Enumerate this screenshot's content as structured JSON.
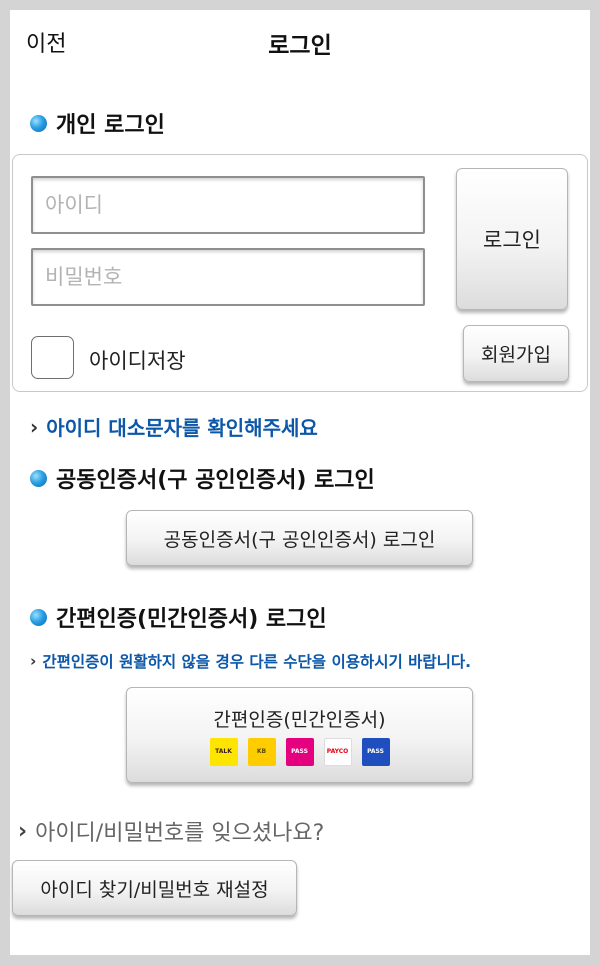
{
  "header": {
    "back_label": "이전",
    "title": "로그인"
  },
  "personal": {
    "title": "개인 로그인",
    "id_placeholder": "아이디",
    "pw_placeholder": "비밀번호",
    "login_button": "로그인",
    "save_id_label": "아이디저장",
    "signup_button": "회원가입"
  },
  "id_hint": "아이디 대소문자를 확인해주세요",
  "cert": {
    "title": "공동인증서(구 공인인증서) 로그인",
    "button": "공동인증서(구 공인인증서) 로그인"
  },
  "simple": {
    "title": "간편인증(민간인증서) 로그인",
    "hint": "간편인증이 원활하지 않을 경우 다른 수단을 이용하시기 바랍니다.",
    "button": "간편인증(민간인증서)",
    "providers": [
      {
        "label": "TALK",
        "color": "#fee500",
        "text_color": "#3c1e1e"
      },
      {
        "label": "KB",
        "color": "#ffcc00",
        "text_color": "#5a4a00"
      },
      {
        "label": "PASS",
        "color": "#e4007f",
        "text_color": "#ffffff"
      },
      {
        "label": "PAYCO",
        "color": "#ffffff",
        "text_color": "#e50012"
      },
      {
        "label": "PASS",
        "color": "#1f4fbf",
        "text_color": "#ffffff"
      }
    ]
  },
  "forgot": {
    "question": "아이디/비밀번호를 잊으셨나요?",
    "button": "아이디 찾기/비밀번호 재설정"
  }
}
